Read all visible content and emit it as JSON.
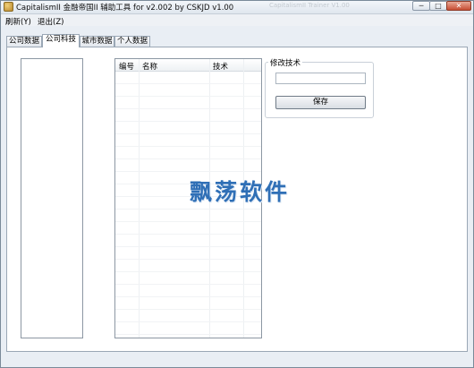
{
  "window": {
    "title": "CapitalismII 金融帝国II 辅助工具 for v2.002 by CSKJD v1.00",
    "title_ghost": "CapitalismII Trainer V1.00",
    "min_label": "─",
    "max_label": "□",
    "close_label": "✕"
  },
  "menu": {
    "refresh": "刷新(Y)",
    "exit": "退出(Z)"
  },
  "tabs": [
    {
      "label": "公司数据"
    },
    {
      "label": "公司科技"
    },
    {
      "label": "城市数据"
    },
    {
      "label": "个人数据"
    }
  ],
  "tech_list": {
    "columns": [
      "编号",
      "名称",
      "技术"
    ]
  },
  "modify": {
    "group_title": "修改技术",
    "value": "",
    "save_label": "保存"
  },
  "watermark": "飘荡软件",
  "colors": {
    "accent": "#2f6fb6",
    "window_bg": "#e9eef4"
  }
}
